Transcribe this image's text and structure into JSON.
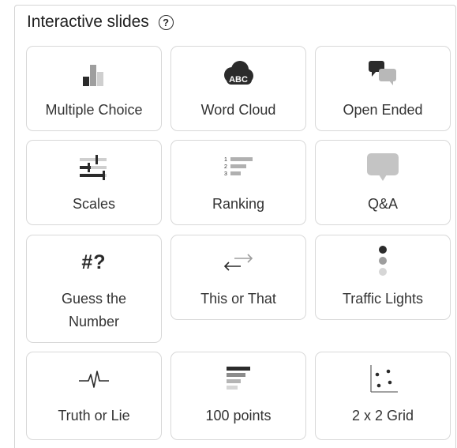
{
  "header": {
    "title": "Interactive slides",
    "help_glyph": "?"
  },
  "cards": [
    {
      "label": "Multiple Choice",
      "icon": "bar-chart-icon"
    },
    {
      "label": "Word Cloud",
      "icon": "cloud-abc-icon",
      "icon_text": "ABC"
    },
    {
      "label": "Open Ended",
      "icon": "speech-bubbles-icon"
    },
    {
      "label": "Scales",
      "icon": "sliders-icon"
    },
    {
      "label": "Ranking",
      "icon": "ranked-list-icon",
      "ranks": [
        "1",
        "2",
        "3"
      ]
    },
    {
      "label": "Q&A",
      "icon": "speech-bubble-icon"
    },
    {
      "label": "Guess the Number",
      "label_line1": "Guess the",
      "label_line2": "Number",
      "icon": "hash-question-icon",
      "icon_text": "#?"
    },
    {
      "label": "This or That",
      "icon": "swap-arrows-icon"
    },
    {
      "label": "Traffic Lights",
      "icon": "traffic-light-icon"
    },
    {
      "label": "Truth or Lie",
      "icon": "pulse-icon"
    },
    {
      "label": "100 points",
      "icon": "stacked-bars-icon"
    },
    {
      "label": "2 x 2 Grid",
      "icon": "quadrant-dots-icon"
    }
  ],
  "colors": {
    "icon_dark": "#2b2b2b",
    "icon_mid": "#9e9e9e",
    "icon_light": "#cfcfcf",
    "border": "#d8d8d8"
  }
}
